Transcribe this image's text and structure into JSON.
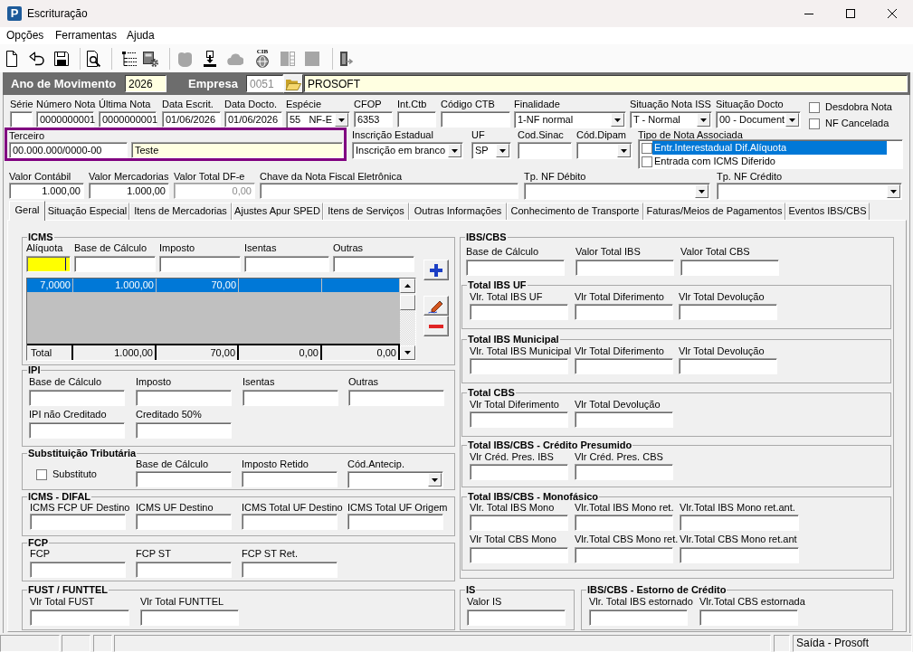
{
  "window": {
    "logo": "P",
    "title": "Escrituração"
  },
  "menu": [
    {
      "label": "Opções"
    },
    {
      "label": "Ferramentas"
    },
    {
      "label": "Ajuda"
    }
  ],
  "toolbar": [
    [
      {
        "kind": "new",
        "disabled": false
      },
      {
        "kind": "undo",
        "disabled": false
      },
      {
        "kind": "save",
        "disabled": false
      }
    ],
    [
      {
        "kind": "preview",
        "disabled": false
      }
    ],
    [
      {
        "kind": "tree",
        "disabled": false
      },
      {
        "kind": "machine",
        "disabled": false
      }
    ],
    [
      {
        "kind": "blob",
        "disabled": true
      },
      {
        "kind": "import",
        "disabled": false
      },
      {
        "kind": "cloud",
        "disabled": true
      },
      {
        "kind": "coin",
        "label": "CIB",
        "disabled": false
      },
      {
        "kind": "split",
        "disabled": true
      },
      {
        "kind": "square",
        "disabled": true
      }
    ],
    [
      {
        "kind": "exit",
        "disabled": false
      }
    ]
  ],
  "header": {
    "year_label": "Ano de Movimento",
    "year": "2026",
    "company_label": "Empresa",
    "company_code": {
      "value": "0051",
      "disabled": true
    },
    "company_name": "PROSOFT"
  },
  "document": {
    "row_1": [
      {
        "kind": "text",
        "label": "Série"
      },
      {
        "kind": "text",
        "label": "Número Nota",
        "value": "0000000001"
      },
      {
        "kind": "text",
        "label": "Última Nota",
        "value": "0000000001"
      },
      {
        "kind": "text",
        "label": "Data Escrit.",
        "value": "01/06/2026"
      },
      {
        "kind": "text",
        "label": "Data Docto.",
        "value": "01/06/2026"
      },
      {
        "kind": "select",
        "label": "Espécie",
        "value": "55   NF-E"
      },
      {
        "kind": "text",
        "label": "CFOP",
        "value": "6353"
      },
      {
        "kind": "text",
        "label": "Int.Ctb"
      },
      {
        "kind": "text",
        "label": "Código CTB"
      },
      {
        "kind": "select",
        "label": "Finalidade",
        "value": "1-NF normal"
      },
      {
        "kind": "select",
        "label": "Situação Nota ISS",
        "value": "T - Normal"
      },
      {
        "kind": "select",
        "label": "Situação Docto",
        "value": "00 - Document"
      }
    ],
    "flags": [
      {
        "label": "Desdobra Nota",
        "checked": false
      },
      {
        "label": "NF Cancelada",
        "checked": false
      }
    ],
    "third_party": {
      "label": "Terceiro",
      "document": "00.000.000/0000-00",
      "name": "Teste"
    },
    "row_2": [
      {
        "kind": "select",
        "label": "Inscrição Estadual",
        "value": "Inscrição em branco"
      },
      {
        "kind": "select",
        "label": "UF",
        "value": "SP"
      },
      {
        "kind": "text",
        "label": "Cod.Sinac"
      },
      {
        "kind": "select",
        "label": "Cód.Dipam"
      }
    ],
    "associated_note": {
      "label": "Tipo de Nota Associada",
      "options": [
        {
          "label": "Entr.Interestadual Dif.Alíquota",
          "checked": false,
          "selected": true
        },
        {
          "label": "Entrada com ICMS Diferido",
          "checked": false,
          "selected": false
        }
      ]
    },
    "row_3": [
      {
        "kind": "text",
        "label": "Valor Contábil",
        "value": "1.000,00",
        "disabled": false
      },
      {
        "kind": "text",
        "label": "Valor Mercadorias",
        "value": "1.000,00",
        "disabled": false
      },
      {
        "kind": "text",
        "label": "Valor Total DF-e",
        "value": "0,00",
        "disabled": true
      },
      {
        "kind": "text",
        "label": "Chave da Nota Fiscal Eletrônica",
        "disabled": false
      },
      {
        "kind": "select",
        "label": "Tp. NF Débito",
        "disabled": false
      },
      {
        "kind": "select",
        "label": "Tp. NF Crédito",
        "disabled": false
      }
    ]
  },
  "tabs": [
    {
      "label": "Geral",
      "selected": true
    },
    {
      "label": "Situação Especial",
      "selected": false
    },
    {
      "label": "Itens de Mercadorias",
      "selected": false
    },
    {
      "label": "Ajustes Apur SPED",
      "selected": false
    },
    {
      "label": "Itens de Serviços",
      "selected": false
    },
    {
      "label": "Outras Informações",
      "selected": false
    },
    {
      "label": "Conhecimento de Transporte",
      "selected": false
    },
    {
      "label": "Faturas/Meios de Pagamentos",
      "selected": false
    },
    {
      "label": "Eventos IBS/CBS",
      "selected": false
    }
  ],
  "icms": {
    "title": "ICMS",
    "inputs": [
      {
        "kind": "text",
        "label": "Alíquota",
        "focused": true
      },
      {
        "kind": "text",
        "label": "Base de Cálculo",
        "focused": false
      },
      {
        "kind": "text",
        "label": "Imposto",
        "focused": false
      },
      {
        "kind": "text",
        "label": "Isentas",
        "focused": false
      },
      {
        "kind": "text",
        "label": "Outras",
        "focused": false
      }
    ],
    "table": {
      "rows": [
        {
          "selected": true,
          "cells": [
            "7,0000",
            "1.000,00",
            "70,00"
          ]
        }
      ],
      "total": {
        "label": "Total",
        "cells": [
          "1.000,00",
          "70,00",
          "0,00",
          "0,00"
        ]
      }
    },
    "actions": [
      {
        "kind": "add"
      },
      {
        "kind": "edit"
      },
      {
        "kind": "remove"
      }
    ]
  },
  "left_groups": [
    {
      "title": "IPI",
      "rows": [
        [
          {
            "kind": "text",
            "label": "Base de Cálculo"
          },
          {
            "kind": "text",
            "label": "Imposto"
          },
          {
            "kind": "text",
            "label": "Isentas"
          },
          {
            "kind": "text",
            "label": "Outras"
          }
        ],
        [
          {
            "kind": "text",
            "label": "IPI não Creditado"
          },
          {
            "kind": "text",
            "label": "Creditado 50%"
          }
        ]
      ]
    },
    {
      "title": "Substituição Tributária",
      "rows": [
        [
          {
            "kind": "check",
            "label": "Substituto",
            "checked": false
          },
          {
            "kind": "text",
            "label": "Base de Cálculo"
          },
          {
            "kind": "text",
            "label": "Imposto Retido"
          },
          {
            "kind": "select",
            "label": "Cód.Antecip."
          }
        ]
      ]
    },
    {
      "title": "ICMS - DIFAL",
      "rows": [
        [
          {
            "kind": "text",
            "label": "ICMS FCP UF Destino"
          },
          {
            "kind": "text",
            "label": "ICMS UF Destino"
          },
          {
            "kind": "text",
            "label": "ICMS Total UF Destino"
          },
          {
            "kind": "text",
            "label": "ICMS Total UF Origem"
          }
        ]
      ]
    },
    {
      "title": "FCP",
      "rows": [
        [
          {
            "kind": "text",
            "label": "FCP"
          },
          {
            "kind": "text",
            "label": "FCP ST"
          },
          {
            "kind": "text",
            "label": "FCP ST Ret."
          }
        ]
      ]
    },
    {
      "title": "FUST / FUNTTEL",
      "rows": [
        [
          {
            "kind": "text",
            "label": "Vlr Total FUST"
          },
          {
            "kind": "text",
            "label": "Vlr Total FUNTTEL"
          }
        ]
      ]
    }
  ],
  "ibs_cbs": {
    "title": "IBS/CBS",
    "rows": [
      [
        {
          "kind": "text",
          "label": "Base de Cálculo"
        },
        {
          "kind": "text",
          "label": "Valor Total IBS"
        },
        {
          "kind": "text",
          "label": "Valor Total CBS"
        }
      ]
    ],
    "subgroups": [
      {
        "title": "Total IBS UF",
        "rows": [
          [
            {
              "kind": "text",
              "label": "Vlr. Total IBS UF"
            },
            {
              "kind": "text",
              "label": "Vlr Total Diferimento"
            },
            {
              "kind": "text",
              "label": "Vlr Total Devolução"
            }
          ]
        ]
      },
      {
        "title": "Total IBS Municipal",
        "rows": [
          [
            {
              "kind": "text",
              "label": "Vlr. Total IBS Municipal"
            },
            {
              "kind": "text",
              "label": "Vlr Total Diferimento"
            },
            {
              "kind": "text",
              "label": "Vlr Total Devolução"
            }
          ]
        ]
      },
      {
        "title": "Total CBS",
        "rows": [
          [
            {
              "kind": "text",
              "label": "Vlr Total Diferimento"
            },
            {
              "kind": "text",
              "label": "Vlr Total Devolução"
            }
          ]
        ]
      },
      {
        "title": "Total IBS/CBS - Crédito Presumido",
        "rows": [
          [
            {
              "kind": "text",
              "label": "Vlr Créd. Pres. IBS"
            },
            {
              "kind": "text",
              "label": "Vlr Créd. Pres. CBS"
            }
          ]
        ]
      },
      {
        "title": "Total IBS/CBS - Monofásico",
        "rows": [
          [
            {
              "kind": "text",
              "label": "Vlr. Total IBS Mono"
            },
            {
              "kind": "text",
              "label": "Vlr.Total IBS Mono ret."
            },
            {
              "kind": "text",
              "label": "Vlr.Total IBS Mono ret.ant."
            }
          ],
          [
            {
              "kind": "text",
              "label": "Vlr Total CBS Mono"
            },
            {
              "kind": "text",
              "label": "Vlr.Total CBS Mono ret."
            },
            {
              "kind": "text",
              "label": "Vlr.Total CBS Mono ret.ant"
            }
          ]
        ]
      }
    ]
  },
  "bottom_groups": [
    {
      "title": "IS",
      "rows": [
        [
          {
            "kind": "text",
            "label": "Valor IS"
          }
        ]
      ]
    },
    {
      "title": "IBS/CBS - Estorno de Crédito",
      "rows": [
        [
          {
            "kind": "text",
            "label": "Vlr. Total IBS estornado"
          },
          {
            "kind": "text",
            "label": "Vlr.Total CBS estornada"
          }
        ]
      ]
    }
  ],
  "status_bar": {
    "text": "Saída - Prosoft"
  }
}
